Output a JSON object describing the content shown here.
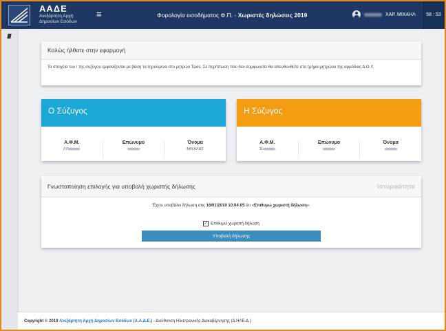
{
  "header": {
    "brand_title": "ΑΑΔΕ",
    "brand_sub1": "Ανεξάρτητη Αρχή",
    "brand_sub2": "Δημοσίων Εσόδων",
    "menu_icon": "≡",
    "app_title_prefix": "Φορολογία εισοδήματος Φ.Π. - ",
    "app_title_bold": "Χωριστές δηλώσεις 2019",
    "user_name": "ΧΑΡ. ΜΙΧΑΗΛ",
    "timer": "58 : 53"
  },
  "welcome": {
    "title": "Καλώς ήλθατε στην εφαρμογή",
    "body": "Τα στοιχεία του / της συζύγου εμφανίζονται με βάση τα τηρούμενα στο μητρώο Taxis. Σε περίπτωση που δεν συμφωνείτε θα απευθυνθείτε στο τμήμα μητρώου της αρμόδιας Δ.Ο.Υ."
  },
  "husband": {
    "title": "Ο Σύζυγος",
    "afm_label": "Α.Φ.Μ.",
    "afm_prefix": "07",
    "surname_label": "Επώνυμο",
    "name_label": "Όνομα",
    "name_value": "ΜΙΧΑΛΗΣ"
  },
  "wife": {
    "title": "Η Σύζυγος",
    "afm_label": "Α.Φ.Μ.",
    "afm_prefix": "11",
    "surname_label": "Επώνυμο",
    "name_label": "Όνομα"
  },
  "notification": {
    "title": "Γνωστοποίηση επιλογής για υποβολή χωριστής δήλωσης",
    "history_label": "Ιστορικότητα",
    "msg_prefix": "Έχετε υποβάλει δήλωση στις ",
    "msg_date": "16/01/2019 10:04:05",
    "msg_middle": " ότι «",
    "msg_choice": "Επιθυμώ χωριστή δήλωση",
    "msg_suffix": "».",
    "checkbox_label": "Επιθυμώ χωριστή δήλωση",
    "checkbox_checked": true,
    "submit_label": "Υποβολή δήλωσης"
  },
  "footer": {
    "prefix": "Copyright © 2019 ",
    "link": "Ανεξάρτητη Αρχή Δημοσίων Εσόδων (Α.Α.Δ.Ε.)",
    "suffix": " - Διεύθυνση Ηλεκτρονικής Διακυβέρνησης (Δ.ΗΛΕ.Δ.)"
  },
  "colors": {
    "topbar": "#1f3763",
    "husband_accent": "#1ba8d6",
    "wife_accent": "#f39c12",
    "button": "#3c8dbc"
  }
}
